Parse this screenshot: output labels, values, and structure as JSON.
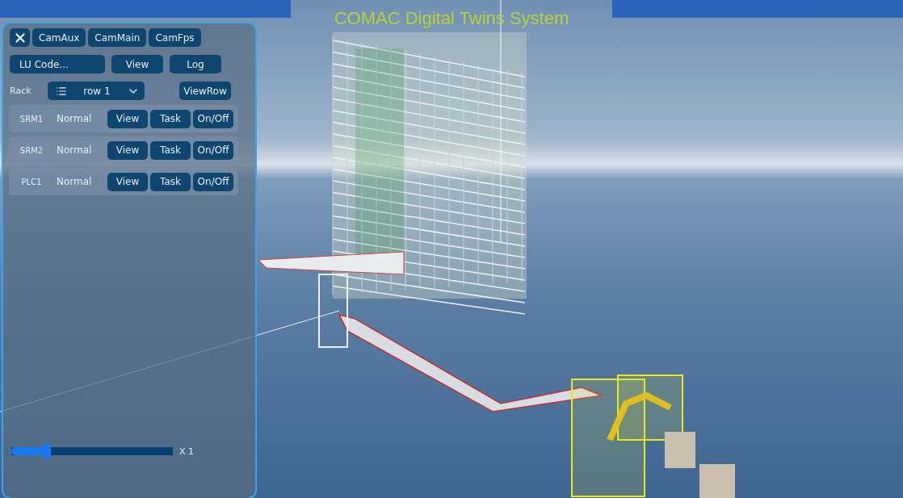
{
  "title": "COMAC Digital Twins System",
  "camera_buttons": [
    {
      "label": "CamAux"
    },
    {
      "label": "CamMain"
    },
    {
      "label": "CamFps"
    }
  ],
  "lu_code": {
    "placeholder": "LU Code..."
  },
  "lu_buttons": [
    {
      "label": "View"
    },
    {
      "label": "Log"
    }
  ],
  "rack": {
    "label": "Rack",
    "value": "row 1",
    "button": "ViewRow"
  },
  "devices": [
    {
      "name": "SRM1",
      "status": "Normal",
      "buttons": [
        "View",
        "Task",
        "On/Off"
      ]
    },
    {
      "name": "SRM2",
      "status": "Normal",
      "buttons": [
        "View",
        "Task",
        "On/Off"
      ]
    },
    {
      "name": "PLC1",
      "status": "Normal",
      "buttons": [
        "View",
        "Task",
        "On/Off"
      ]
    }
  ],
  "speed": {
    "level": 0.22,
    "reading": "X 1"
  }
}
